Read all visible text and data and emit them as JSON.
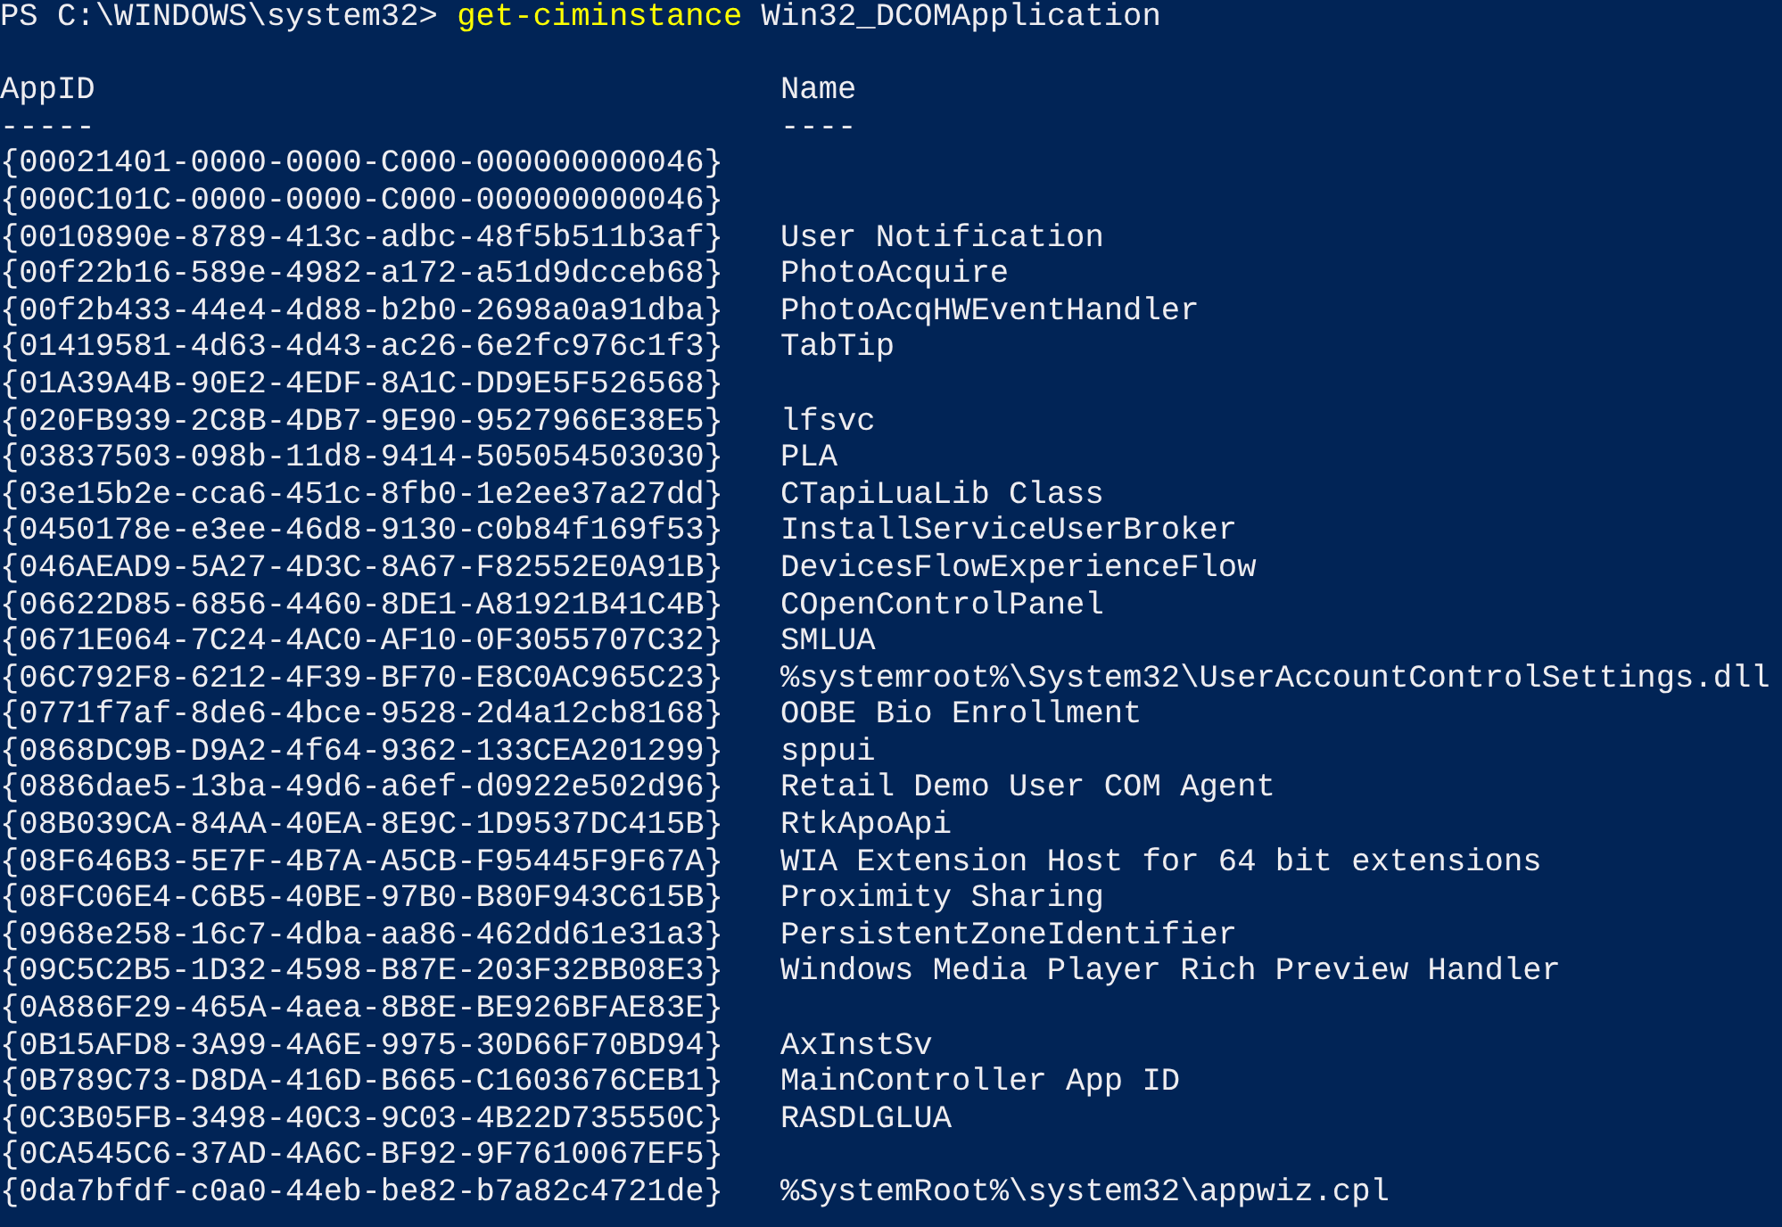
{
  "prompt": {
    "path": "PS C:\\WINDOWS\\system32>",
    "command": "get-ciminstance",
    "argument": "Win32_DCOMApplication"
  },
  "table": {
    "columns": [
      {
        "header": "AppID",
        "underline": "-----"
      },
      {
        "header": "Name",
        "underline": "----"
      }
    ],
    "rows": [
      {
        "app_id": "{00021401-0000-0000-C000-000000000046}"
      },
      {
        "app_id": "{000C101C-0000-0000-C000-000000000046}"
      },
      {
        "app_id": "{0010890e-8789-413c-adbc-48f5b511b3af}",
        "name": "User Notification"
      },
      {
        "app_id": "{00f22b16-589e-4982-a172-a51d9dcceb68}",
        "name": "PhotoAcquire"
      },
      {
        "app_id": "{00f2b433-44e4-4d88-b2b0-2698a0a91dba}",
        "name": "PhotoAcqHWEventHandler"
      },
      {
        "app_id": "{01419581-4d63-4d43-ac26-6e2fc976c1f3}",
        "name": "TabTip"
      },
      {
        "app_id": "{01A39A4B-90E2-4EDF-8A1C-DD9E5F526568}"
      },
      {
        "app_id": "{020FB939-2C8B-4DB7-9E90-9527966E38E5}",
        "name": "lfsvc"
      },
      {
        "app_id": "{03837503-098b-11d8-9414-505054503030}",
        "name": "PLA"
      },
      {
        "app_id": "{03e15b2e-cca6-451c-8fb0-1e2ee37a27dd}",
        "name": "CTapiLuaLib Class"
      },
      {
        "app_id": "{0450178e-e3ee-46d8-9130-c0b84f169f53}",
        "name": "InstallServiceUserBroker"
      },
      {
        "app_id": "{046AEAD9-5A27-4D3C-8A67-F82552E0A91B}",
        "name": "DevicesFlowExperienceFlow"
      },
      {
        "app_id": "{06622D85-6856-4460-8DE1-A81921B41C4B}",
        "name": "COpenControlPanel"
      },
      {
        "app_id": "{0671E064-7C24-4AC0-AF10-0F3055707C32}",
        "name": "SMLUA"
      },
      {
        "app_id": "{06C792F8-6212-4F39-BF70-E8C0AC965C23}",
        "name": "%systemroot%\\System32\\UserAccountControlSettings.dll"
      },
      {
        "app_id": "{0771f7af-8de6-4bce-9528-2d4a12cb8168}",
        "name": "OOBE Bio Enrollment"
      },
      {
        "app_id": "{0868DC9B-D9A2-4f64-9362-133CEA201299}",
        "name": "sppui"
      },
      {
        "app_id": "{0886dae5-13ba-49d6-a6ef-d0922e502d96}",
        "name": "Retail Demo User COM Agent"
      },
      {
        "app_id": "{08B039CA-84AA-40EA-8E9C-1D9537DC415B}",
        "name": "RtkApoApi"
      },
      {
        "app_id": "{08F646B3-5E7F-4B7A-A5CB-F95445F9F67A}",
        "name": "WIA Extension Host for 64 bit extensions"
      },
      {
        "app_id": "{08FC06E4-C6B5-40BE-97B0-B80F943C615B}",
        "name": "Proximity Sharing"
      },
      {
        "app_id": "{0968e258-16c7-4dba-aa86-462dd61e31a3}",
        "name": "PersistentZoneIdentifier"
      },
      {
        "app_id": "{09C5C2B5-1D32-4598-B87E-203F32BB08E3}",
        "name": "Windows Media Player Rich Preview Handler"
      },
      {
        "app_id": "{0A886F29-465A-4aea-8B8E-BE926BFAE83E}"
      },
      {
        "app_id": "{0B15AFD8-3A99-4A6E-9975-30D66F70BD94}",
        "name": "AxInstSv"
      },
      {
        "app_id": "{0B789C73-D8DA-416D-B665-C1603676CEB1}",
        "name": "MainController App ID"
      },
      {
        "app_id": "{0C3B05FB-3498-40C3-9C03-4B22D735550C}",
        "name": "RASDLGLUA"
      },
      {
        "app_id": "{0CA545C6-37AD-4A6C-BF92-9F7610067EF5}"
      },
      {
        "app_id": "{0da7bfdf-c0a0-44eb-be82-b7a82c4721de}",
        "name": "%SystemRoot%\\system32\\appwiz.cpl"
      }
    ]
  }
}
